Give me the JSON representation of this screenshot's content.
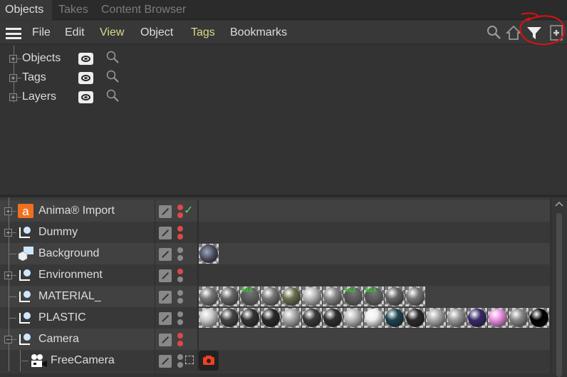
{
  "tabs": [
    "Objects",
    "Takes",
    "Content Browser"
  ],
  "menu": [
    "File",
    "Edit",
    "View",
    "Object",
    "Tags",
    "Bookmarks"
  ],
  "toolbar_icons": [
    "search-icon",
    "home-icon",
    "filter-icon",
    "new-view-icon"
  ],
  "annotation_color": "#e01010",
  "filters": [
    {
      "label": "Objects"
    },
    {
      "label": "Tags"
    },
    {
      "label": "Layers"
    }
  ],
  "objects": [
    {
      "name": "Anima® Import",
      "icon": "anima-icon",
      "expand": "plus",
      "dots": [
        "#e04848",
        "#e04848"
      ],
      "check": "✓",
      "tags": []
    },
    {
      "name": "Dummy",
      "icon": "null-icon",
      "expand": "plus",
      "dots": [
        "#e04848",
        "#e04848"
      ],
      "tags": []
    },
    {
      "name": "Background",
      "icon": "background-icon",
      "expand": "none",
      "dots": [
        "#8a8a8a",
        "#8a8a8a"
      ],
      "tags": [
        "radial-gradient(circle at 40% 40%,#9ab 0,#445 50%,#223 80%)"
      ]
    },
    {
      "name": "Environment",
      "icon": "null-icon",
      "expand": "plus",
      "dots": [
        "#e04848",
        "#8a8a8a"
      ],
      "tags": []
    },
    {
      "name": "MATERIAL_",
      "icon": "null-icon",
      "expand": "none",
      "dots": [
        "#8a8a8a",
        "#8a8a8a"
      ],
      "tags": [
        "#777",
        "#666",
        "MIX",
        "#777",
        "#6a7050",
        "#bbb",
        "#888",
        "MIX",
        "MIX",
        "#666",
        "#777"
      ]
    },
    {
      "name": "PLASTIC",
      "icon": "null-icon",
      "expand": "none",
      "dots": [
        "#8a8a8a",
        "#8a8a8a"
      ],
      "tags": [
        "#ccc",
        "#444",
        "#333",
        "#2a2a2a",
        "#aaa",
        "#3a3a3a",
        "#2e2e2e",
        "#bbb",
        "#eee",
        "#1e4450",
        "#2a2a2a",
        "#aaa",
        "#999",
        "#3a2a6a",
        "#e890e0",
        "#888",
        "#000"
      ]
    },
    {
      "name": "Camera",
      "icon": "null-icon",
      "expand": "minus",
      "dots": [
        "#e04848",
        "#e04848"
      ],
      "tags": []
    },
    {
      "name": "FreeCamera",
      "icon": "camera-icon",
      "expand": "none",
      "dots": [
        "#8a8a8a",
        "#8a8a8a"
      ],
      "tags": [
        "camera-tag"
      ]
    }
  ]
}
